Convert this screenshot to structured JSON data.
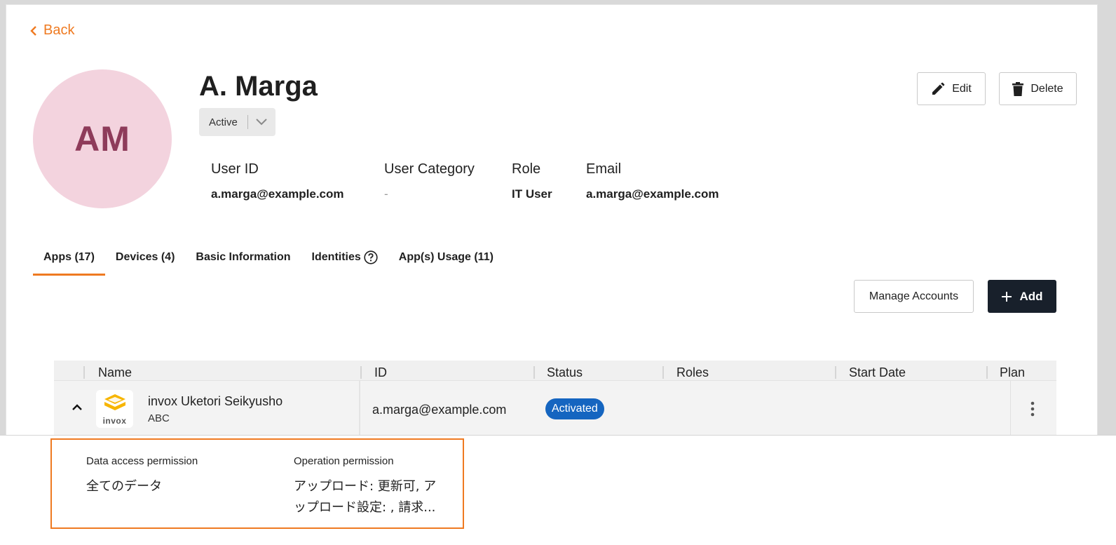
{
  "nav": {
    "back_label": "Back"
  },
  "user": {
    "initials": "AM",
    "name": "A. Marga",
    "status": "Active"
  },
  "actions": {
    "edit_label": "Edit",
    "delete_label": "Delete"
  },
  "details": [
    {
      "label": "User ID",
      "value": "a.marga@example.com"
    },
    {
      "label": "User Category",
      "value": "-"
    },
    {
      "label": "Role",
      "value": "IT User"
    },
    {
      "label": "Email",
      "value": "a.marga@example.com"
    }
  ],
  "tabs": [
    {
      "label": "Apps (17)",
      "active": true
    },
    {
      "label": "Devices (4)"
    },
    {
      "label": "Basic Information"
    },
    {
      "label": "Identities"
    },
    {
      "label": "App(s) Usage (11)"
    }
  ],
  "toolbar": {
    "manage_label": "Manage Accounts",
    "add_label": "Add"
  },
  "table": {
    "columns": [
      "Name",
      "ID",
      "Status",
      "Roles",
      "Start Date",
      "Plan"
    ],
    "rows": [
      {
        "app_name": "invox Uketori Seikyusho",
        "org": "ABC",
        "logo_text": "invox",
        "id": "a.marga@example.com",
        "status": "Activated"
      }
    ]
  },
  "permissions": {
    "data_access_label": "Data access permission",
    "data_access_value": "全てのデータ",
    "operation_label": "Operation permission",
    "operation_value_line1": "アップロード: 更新可, ア",
    "operation_value_line2": "ップロード設定: , 請求..."
  },
  "colors": {
    "accent": "#ef7a21",
    "primary_dark": "#18202b",
    "status_activated": "#1565c0",
    "avatar_bg": "#f3d3de",
    "avatar_text": "#8e3b5a"
  },
  "icons": {
    "back": "chevron-left-icon",
    "edit": "pencil-icon",
    "delete": "trash-icon",
    "help": "question-circle-icon",
    "add": "plus-icon",
    "expand": "chevron-up-icon",
    "menu": "more-vertical-icon"
  }
}
